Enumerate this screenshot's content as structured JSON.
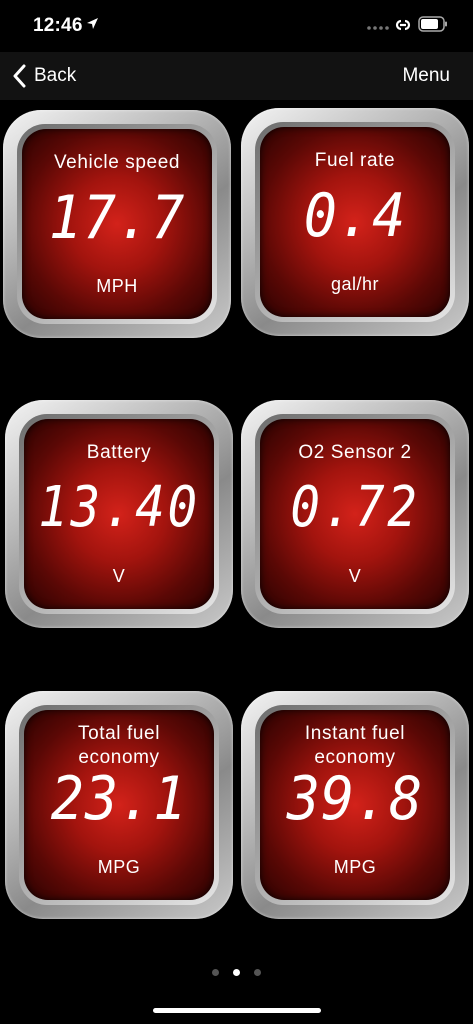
{
  "status_bar": {
    "time": "12:46"
  },
  "nav": {
    "back_label": "Back",
    "menu_label": "Menu"
  },
  "gauges": [
    {
      "label": "Vehicle speed",
      "value": "17.7",
      "unit": "MPH"
    },
    {
      "label": "Fuel rate",
      "value": "0.4",
      "unit": "gal/hr"
    },
    {
      "label": "Battery",
      "value": "13.40",
      "unit": "V"
    },
    {
      "label": "O2 Sensor 2",
      "value": "0.72",
      "unit": "V"
    },
    {
      "label": "Total fuel economy",
      "value": "23.1",
      "unit": "MPG"
    },
    {
      "label": "Instant fuel economy",
      "value": "39.8",
      "unit": "MPG"
    }
  ],
  "pager": {
    "page_count": 3,
    "current_page": 2
  },
  "colors": {
    "background": "#000000",
    "gauge_face": "#c41e16",
    "text": "#ffffff"
  }
}
